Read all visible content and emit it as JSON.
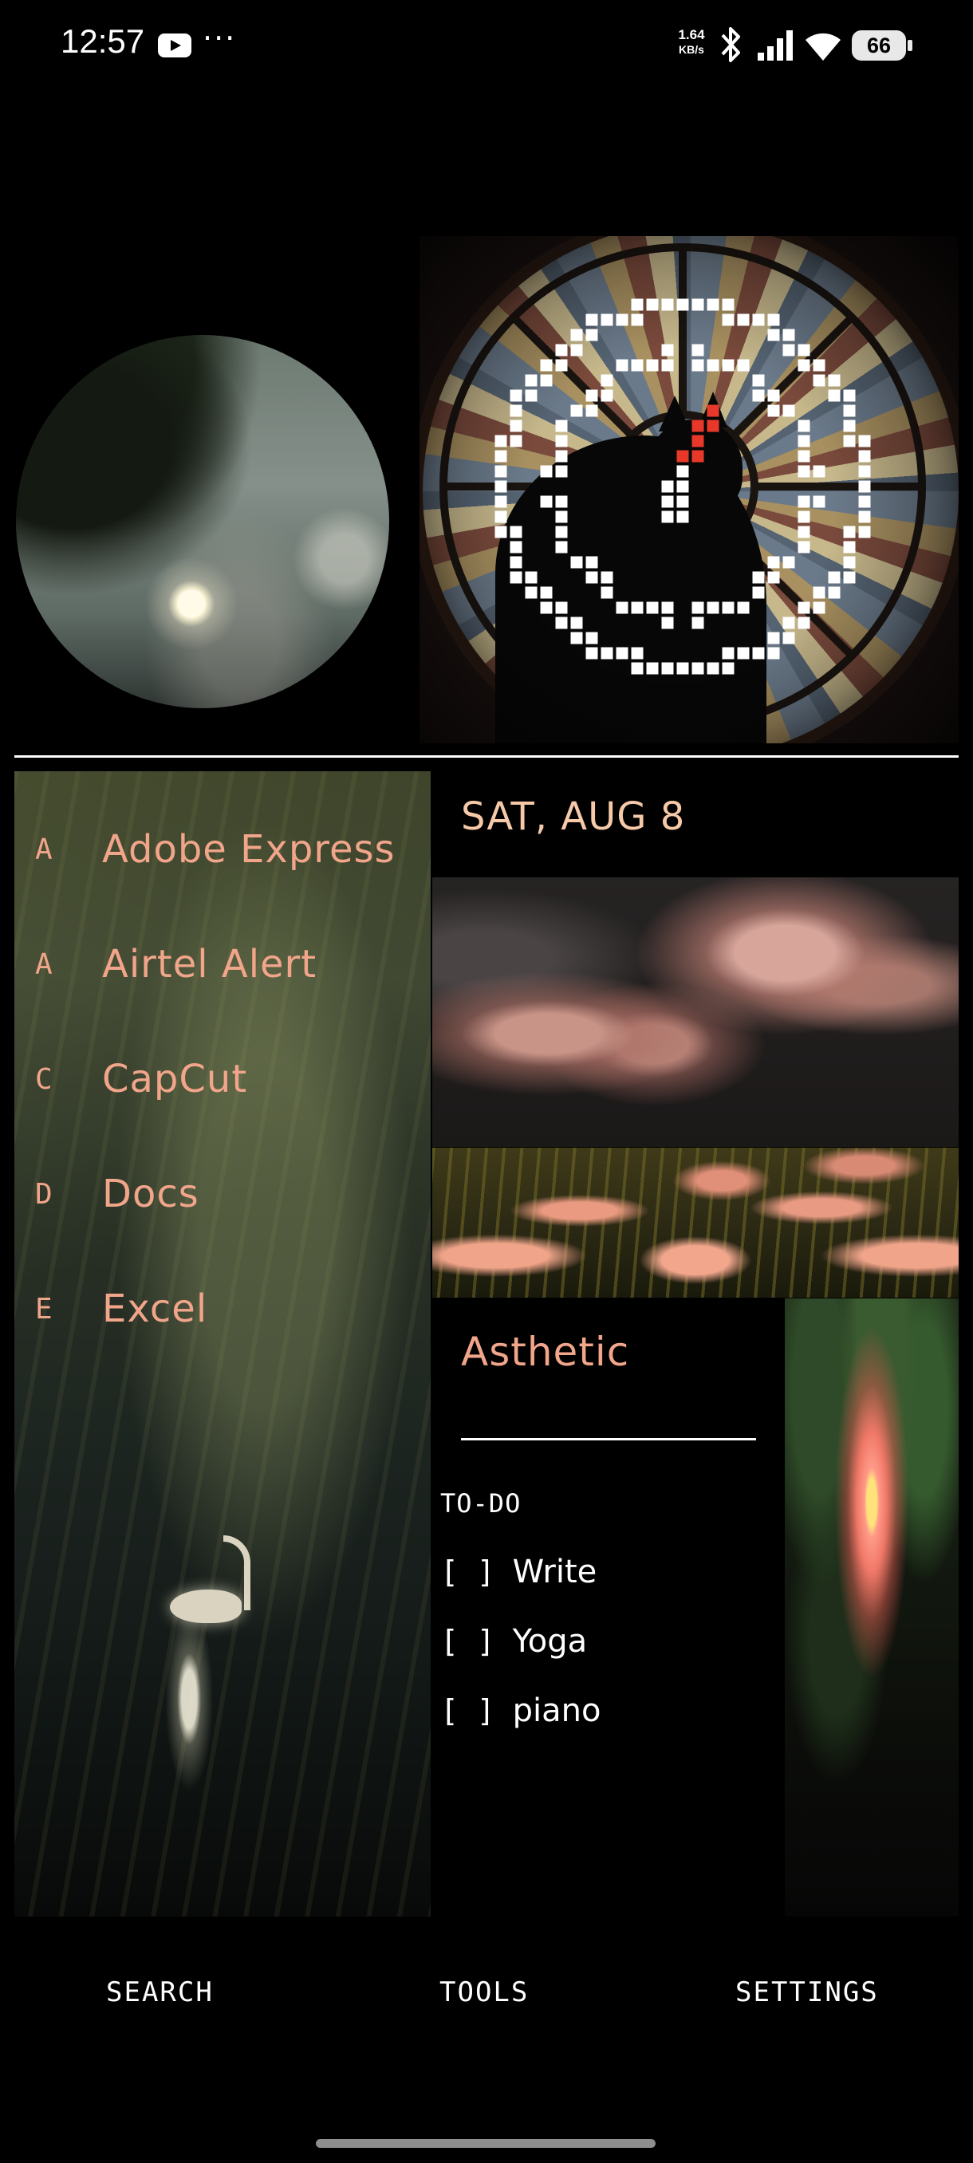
{
  "status_bar": {
    "time": "12:57",
    "net_speed_value": "1.64",
    "net_speed_unit": "KB/s",
    "battery": "66",
    "icons": [
      "youtube-icon",
      "more-dots-icon",
      "bluetooth-icon",
      "signal-icon",
      "wifi-icon",
      "battery-icon"
    ]
  },
  "widgets": {
    "moon_image": "moon-painting",
    "clock_image": "stained-glass-cat-clock"
  },
  "date": "SAT, AUG 8",
  "apps": [
    {
      "letter": "A",
      "name": "Adobe Express"
    },
    {
      "letter": "A",
      "name": "Airtel Alert"
    },
    {
      "letter": "C",
      "name": "CapCut"
    },
    {
      "letter": "D",
      "name": "Docs"
    },
    {
      "letter": "E",
      "name": "Excel"
    }
  ],
  "note": {
    "title": "Asthetic",
    "todo_header": "TO-DO",
    "items": [
      {
        "box": "[ ]",
        "text": "Write"
      },
      {
        "box": "[ ]",
        "text": "Yoga"
      },
      {
        "box": "[ ]",
        "text": "piano"
      }
    ]
  },
  "bottom_nav": {
    "search": "SEARCH",
    "tools": "TOOLS",
    "settings": "SETTINGS"
  },
  "colors": {
    "accent": "#f1a58a",
    "date": "#f6c9a8",
    "background": "#000000",
    "clock_hand": "#e8382a"
  }
}
